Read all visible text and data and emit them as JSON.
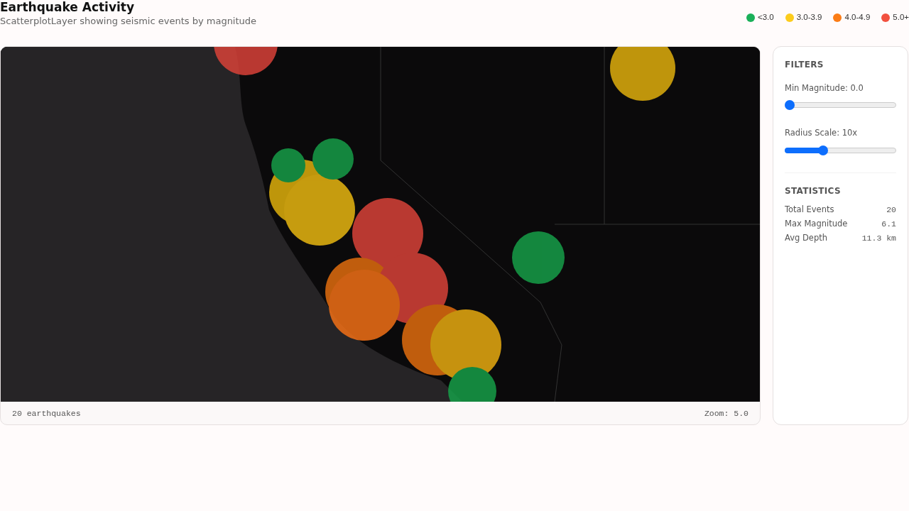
{
  "header": {
    "title": "Earthquake Activity",
    "subtitle": "ScatterplotLayer showing seismic events by magnitude"
  },
  "legend": [
    {
      "label": "<3.0",
      "color": "#1ab059"
    },
    {
      "label": "3.0-3.9",
      "color": "#fccc1c"
    },
    {
      "label": "4.0-4.9",
      "color": "#fb7c16"
    },
    {
      "label": "5.0+",
      "color": "#f2513f"
    }
  ],
  "map_footer": {
    "count": "20 earthquakes",
    "zoom": "Zoom: 5.0"
  },
  "filters": {
    "title": "FILTERS",
    "sliders": [
      {
        "label": "Min Magnitude: 0.0",
        "level": 0
      },
      {
        "label": "Radius Scale: 10x",
        "level": 0.33
      }
    ]
  },
  "statistics": {
    "title": "STATISTICS",
    "rows": [
      {
        "label": "Total Events",
        "value": "20"
      },
      {
        "label": "Max Magnitude",
        "value": "6.1"
      },
      {
        "label": "Avg Depth",
        "value": "11.3 km"
      }
    ]
  }
}
